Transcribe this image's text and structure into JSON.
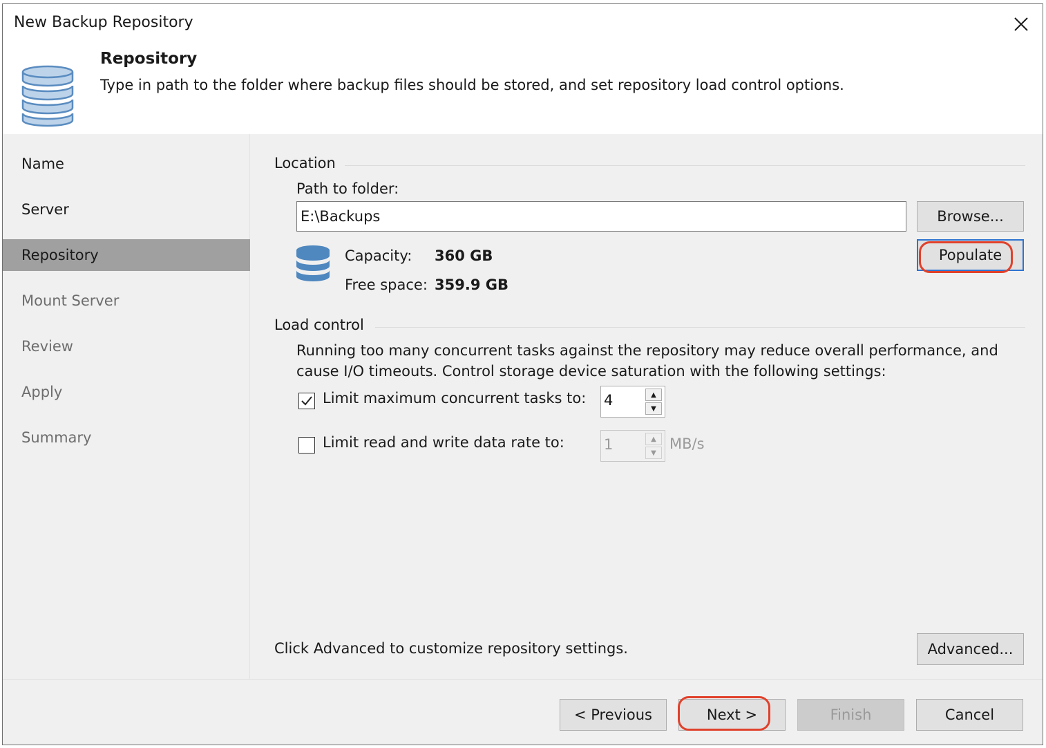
{
  "window": {
    "title": "New Backup Repository",
    "close_icon": "close-icon"
  },
  "header": {
    "icon": "database-icon",
    "title": "Repository",
    "description": "Type in path to the folder where backup files should be stored, and set repository load control options."
  },
  "sidebar": {
    "items": [
      {
        "label": "Name",
        "state": "done"
      },
      {
        "label": "Server",
        "state": "done"
      },
      {
        "label": "Repository",
        "state": "active"
      },
      {
        "label": "Mount Server",
        "state": "pending"
      },
      {
        "label": "Review",
        "state": "pending"
      },
      {
        "label": "Apply",
        "state": "pending"
      },
      {
        "label": "Summary",
        "state": "pending"
      }
    ]
  },
  "location": {
    "group_label": "Location",
    "path_label": "Path to folder:",
    "path_value": "E:\\Backups",
    "browse_label": "Browse...",
    "populate_label": "Populate",
    "capacity_label": "Capacity:",
    "capacity_value": "360 GB",
    "free_label": "Free space:",
    "free_value": "359.9 GB"
  },
  "load_control": {
    "group_label": "Load control",
    "description": "Running too many concurrent tasks against the repository may reduce overall performance, and cause I/O timeouts. Control storage device saturation with the following settings:",
    "limit_tasks": {
      "label": "Limit maximum concurrent tasks to:",
      "checked": true,
      "value": "4"
    },
    "limit_rate": {
      "label": "Limit read and write data rate to:",
      "checked": false,
      "value": "1",
      "unit": "MB/s"
    }
  },
  "advanced": {
    "hint": "Click Advanced to customize repository settings.",
    "button_label": "Advanced..."
  },
  "footer": {
    "previous_label": "< Previous",
    "next_label": "Next >",
    "finish_label": "Finish",
    "cancel_label": "Cancel"
  },
  "colors": {
    "highlight_ring": "#e0412b",
    "focus_border": "#2f74d0",
    "icon_blue": "#4f87bf"
  }
}
